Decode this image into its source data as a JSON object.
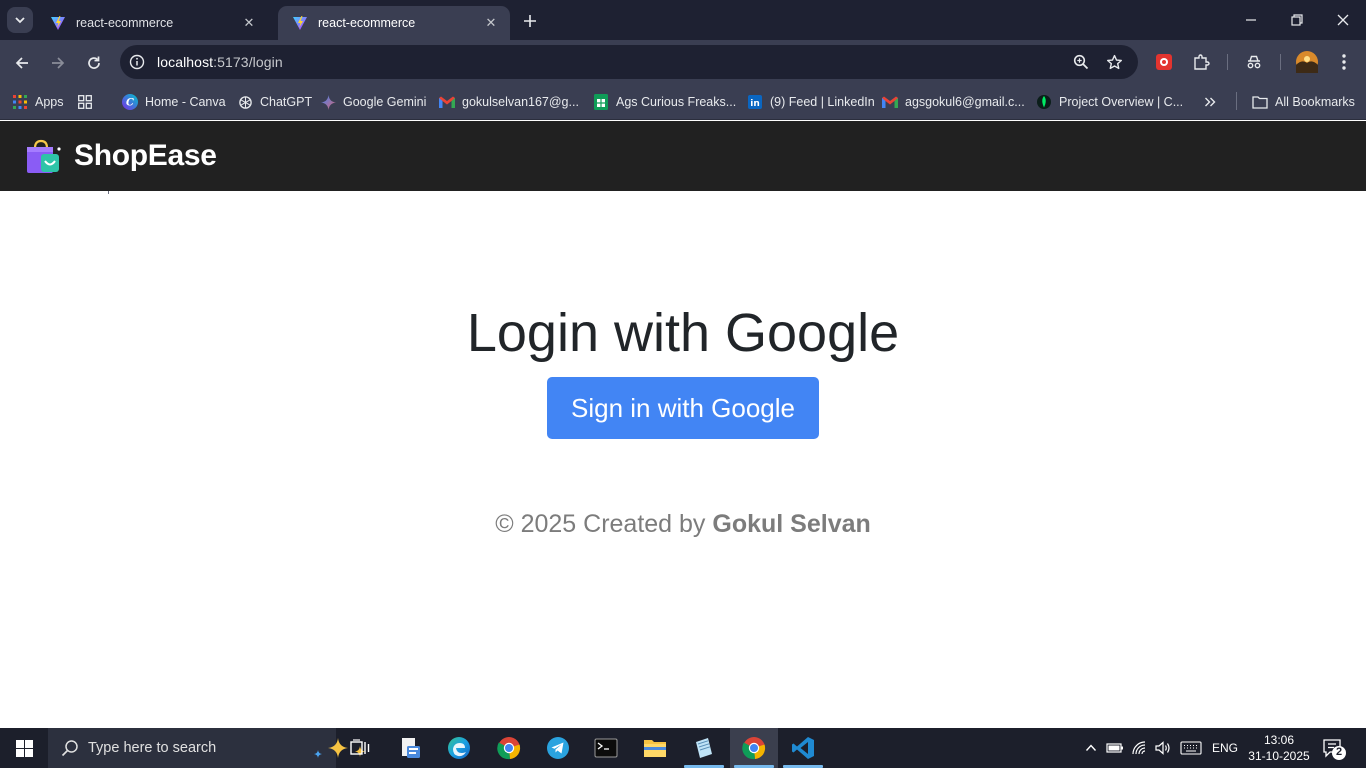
{
  "browser": {
    "tabs": [
      {
        "title": "react-ecommerce",
        "active": false
      },
      {
        "title": "react-ecommerce",
        "active": true
      }
    ],
    "url_host": "localhost",
    "url_path": ":5173/login",
    "bookmarks": [
      {
        "label": "Apps",
        "icon": "apps-grid-icon"
      },
      {
        "label": "",
        "icon": "tab-groups-icon"
      },
      {
        "label": "Home - Canva",
        "icon": "canva-icon"
      },
      {
        "label": "ChatGPT",
        "icon": "chatgpt-icon"
      },
      {
        "label": "Google Gemini",
        "icon": "gemini-icon"
      },
      {
        "label": "gokulselvan167@g...",
        "icon": "gmail-icon"
      },
      {
        "label": "Ags Curious Freaks...",
        "icon": "sheets-icon"
      },
      {
        "label": "(9) Feed | LinkedIn",
        "icon": "linkedin-icon"
      },
      {
        "label": "agsgokul6@gmail.c...",
        "icon": "gmail-icon"
      },
      {
        "label": "Project Overview | C...",
        "icon": "mongodb-icon"
      }
    ],
    "all_bookmarks": "All Bookmarks"
  },
  "site": {
    "brand": "ShopEase"
  },
  "login": {
    "title": "Login with Google",
    "button_label": "Sign in with Google"
  },
  "footer": {
    "prefix": "© 2025 Created by ",
    "author": "Gokul Selvan"
  },
  "taskbar": {
    "search_placeholder": "Type here to search",
    "language": "ENG",
    "time": "13:06",
    "date": "31-10-2025",
    "notification_count": "2"
  },
  "colors": {
    "accent": "#4285f4",
    "navbar": "#212121",
    "chrome": "#3a3e52"
  }
}
